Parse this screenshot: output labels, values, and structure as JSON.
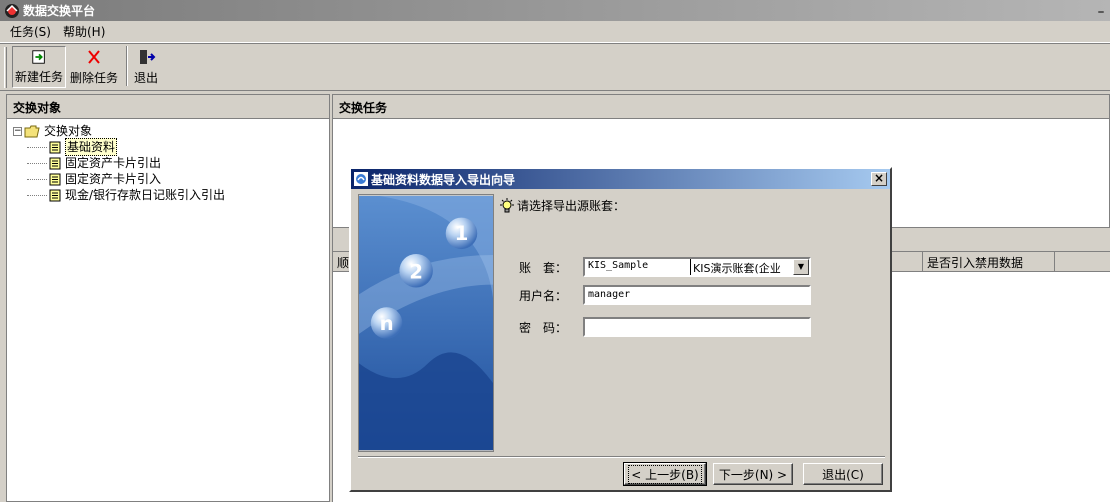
{
  "window": {
    "title": "数据交换平台",
    "minimize": "_"
  },
  "menu": {
    "items": [
      "任务(S)",
      "帮助(H)"
    ]
  },
  "toolbar": {
    "new_task": "新建任务",
    "delete_task": "删除任务",
    "exit": "退出"
  },
  "left_pane": {
    "header": "交换对象",
    "tree": {
      "root": "交换对象",
      "children": [
        "基础资料",
        "固定资产卡片引出",
        "固定资产卡片引入",
        "现金/银行存款日记账引入引出"
      ],
      "selected": "基础资料"
    }
  },
  "right_pane": {
    "header": "交换任务",
    "grid_columns": [
      "顺",
      "是否引入禁用数据"
    ]
  },
  "dialog": {
    "title": "基础资料数据导入导出向导",
    "close": "×",
    "prompt": "请选择导出源账套：",
    "art_numbers": [
      "1",
      "2",
      "n"
    ],
    "fields": {
      "account_label": "账　套：",
      "account_code": "KIS_Sample",
      "account_name": "KIS演示账套(企业",
      "username_label": "用户名：",
      "username_value": "manager",
      "password_label": "密　码：",
      "password_value": ""
    },
    "buttons": {
      "prev": "< 上一步(B)",
      "next": "下一步(N) >",
      "exit": "退出(C)"
    }
  }
}
